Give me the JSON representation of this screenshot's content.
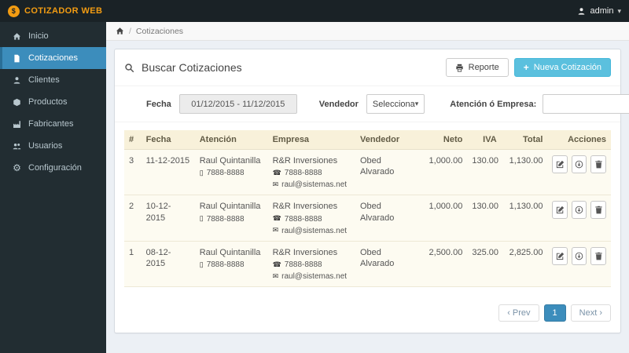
{
  "colors": {
    "accent": "#3c8dbc",
    "brand_orange": "#f39c12",
    "info_blue": "#5bc0de",
    "sidebar_bg": "#222d32",
    "navbar_bg": "#1a2226",
    "table_header_bg": "#f8f1da"
  },
  "navbar": {
    "brand": "COTIZADOR WEB",
    "user": "admin"
  },
  "sidebar": {
    "items": [
      {
        "label": "Inicio"
      },
      {
        "label": "Cotizaciones"
      },
      {
        "label": "Clientes"
      },
      {
        "label": "Productos"
      },
      {
        "label": "Fabricantes"
      },
      {
        "label": "Usuarios"
      },
      {
        "label": "Configuración"
      }
    ]
  },
  "breadcrumb": {
    "current": "Cotizaciones"
  },
  "panel": {
    "title": "Buscar Cotizaciones",
    "buttons": {
      "report": "Reporte",
      "new": "Nueva Cotización"
    },
    "filters": {
      "fecha_label": "Fecha",
      "fecha_value": "01/12/2015 - 11/12/2015",
      "vendedor_label": "Vendedor",
      "vendedor_selected": "Selecciona",
      "atencion_label": "Atención ó Empresa:"
    },
    "table": {
      "headers": [
        "#",
        "Fecha",
        "Atención",
        "Empresa",
        "Vendedor",
        "Neto",
        "IVA",
        "Total",
        "Acciones"
      ],
      "rows": [
        {
          "num": "3",
          "fecha": "11-12-2015",
          "atencion": "Raul Quintanilla",
          "atencion_tel": "7888-8888",
          "empresa": "R&R Inversiones",
          "empresa_tel": "7888-8888",
          "empresa_email": "raul@sistemas.net",
          "vendedor": "Obed Alvarado",
          "neto": "1,000.00",
          "iva": "130.00",
          "total": "1,130.00"
        },
        {
          "num": "2",
          "fecha": "10-12-2015",
          "atencion": "Raul Quintanilla",
          "atencion_tel": "7888-8888",
          "empresa": "R&R Inversiones",
          "empresa_tel": "7888-8888",
          "empresa_email": "raul@sistemas.net",
          "vendedor": "Obed Alvarado",
          "neto": "1,000.00",
          "iva": "130.00",
          "total": "1,130.00"
        },
        {
          "num": "1",
          "fecha": "08-12-2015",
          "atencion": "Raul Quintanilla",
          "atencion_tel": "7888-8888",
          "empresa": "R&R Inversiones",
          "empresa_tel": "7888-8888",
          "empresa_email": "raul@sistemas.net",
          "vendedor": "Obed Alvarado",
          "neto": "2,500.00",
          "iva": "325.00",
          "total": "2,825.00"
        }
      ]
    },
    "pagination": {
      "prev": "‹ Prev",
      "current": "1",
      "next": "Next ›"
    }
  },
  "icons": {
    "gear": "⚙",
    "phone": "☎",
    "mobile": "▯",
    "mail": "✉",
    "caret": "▾",
    "plus": "+",
    "separator": "/",
    "brand_glyph": "$"
  }
}
